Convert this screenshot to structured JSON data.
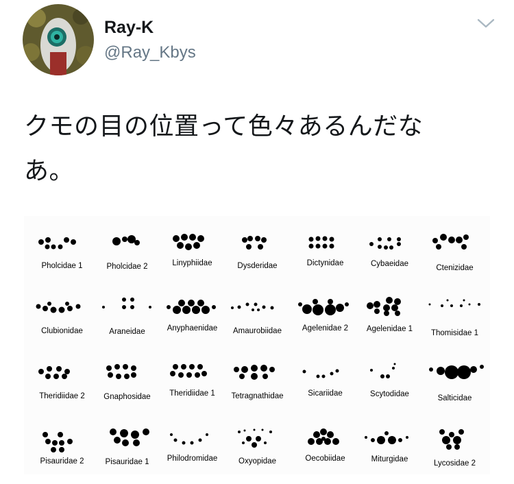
{
  "tweet": {
    "display_name": "Ray-K",
    "handle": "@Ray_Kbys",
    "text_line1": "クモの目の位置って色々あるんだな",
    "text_line2": "あ。",
    "menu_icon": "chevron-down-icon",
    "avatar_icon": "avatar-image"
  },
  "figure": {
    "families": [
      "Pholcidae 1",
      "Pholcidae 2",
      "Linyphiidae",
      "Dysderidae",
      "Dictynidae",
      "Cybaeidae",
      "Ctenizidae",
      "Clubionidae",
      "Araneidae",
      "Anyphaenidae",
      "Amaurobiidae",
      "Agelenidae 2",
      "Agelenidae 1",
      "Thomisidae 1",
      "Theridiidae 2",
      "Gnaphosidae",
      "Theridiidae 1",
      "Tetragnathidae",
      "Sicariidae",
      "Scytodidae",
      "Salticidae",
      "Pisauridae 2",
      "Pisauridae 1",
      "Philodromidae",
      "Oxyopidae",
      "Oecobiidae",
      "Miturgidae",
      "Lycosidae 2"
    ]
  },
  "colors": {
    "text": "#14171a",
    "muted": "#657786",
    "eye": "#000000"
  }
}
